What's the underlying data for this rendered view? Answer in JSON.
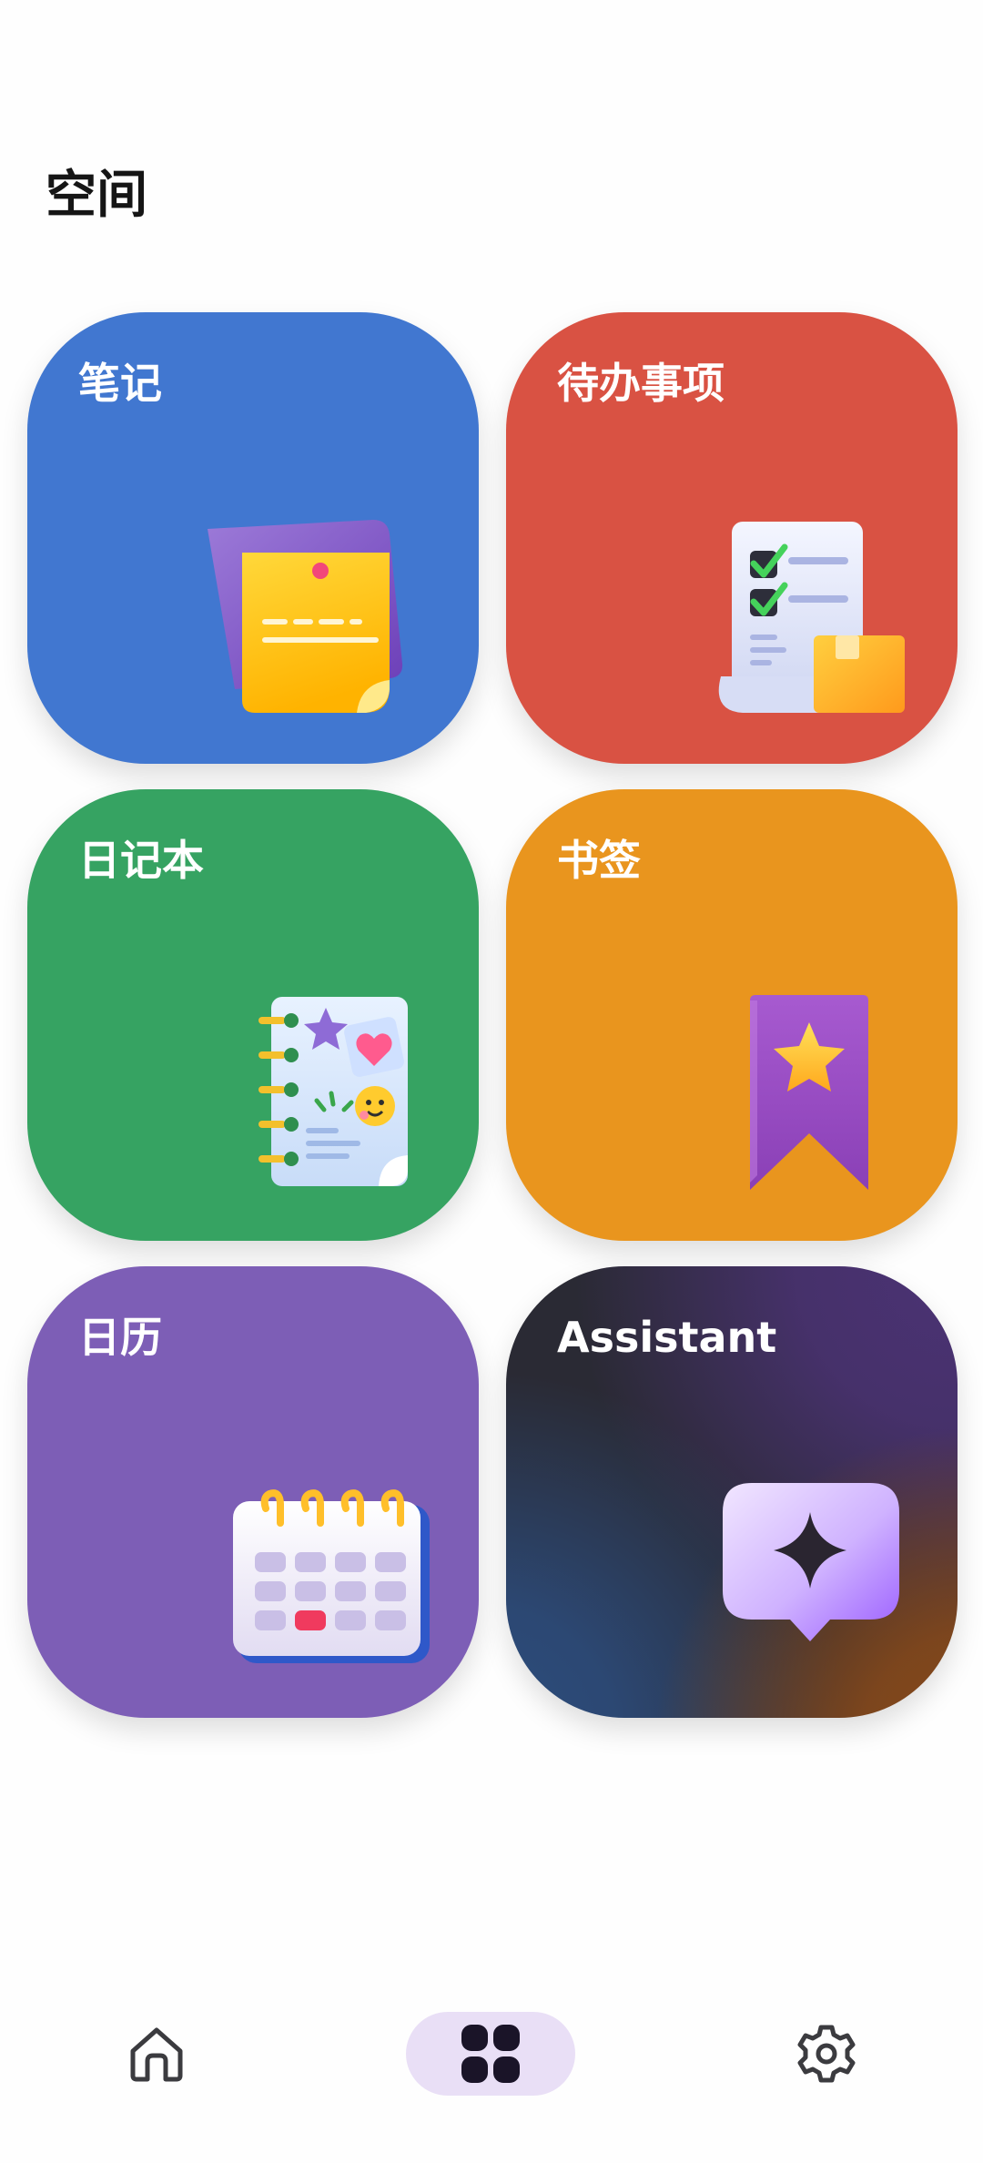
{
  "page": {
    "title": "空间"
  },
  "tiles": [
    {
      "id": "notes",
      "label": "笔记",
      "color": "#4177d0",
      "icon": "sticky-note-icon"
    },
    {
      "id": "todo",
      "label": "待办事项",
      "color": "#d95243",
      "icon": "checklist-icon"
    },
    {
      "id": "diary",
      "label": "日记本",
      "color": "#36a362",
      "icon": "journal-icon"
    },
    {
      "id": "bookmarks",
      "label": "书签",
      "color": "#e9951e",
      "icon": "bookmark-star-icon"
    },
    {
      "id": "calendar",
      "label": "日历",
      "color": "#7d5eb6",
      "icon": "calendar-icon"
    },
    {
      "id": "assistant",
      "label": "Assistant",
      "color": "#2a2a34",
      "icon": "sparkle-chat-icon"
    }
  ],
  "bottom_nav": {
    "items": [
      {
        "id": "home",
        "icon": "home-icon",
        "active": false
      },
      {
        "id": "spaces",
        "icon": "grid-icon",
        "active": true
      },
      {
        "id": "settings",
        "icon": "gear-icon",
        "active": false
      }
    ],
    "active_color": "#e9dff6"
  }
}
